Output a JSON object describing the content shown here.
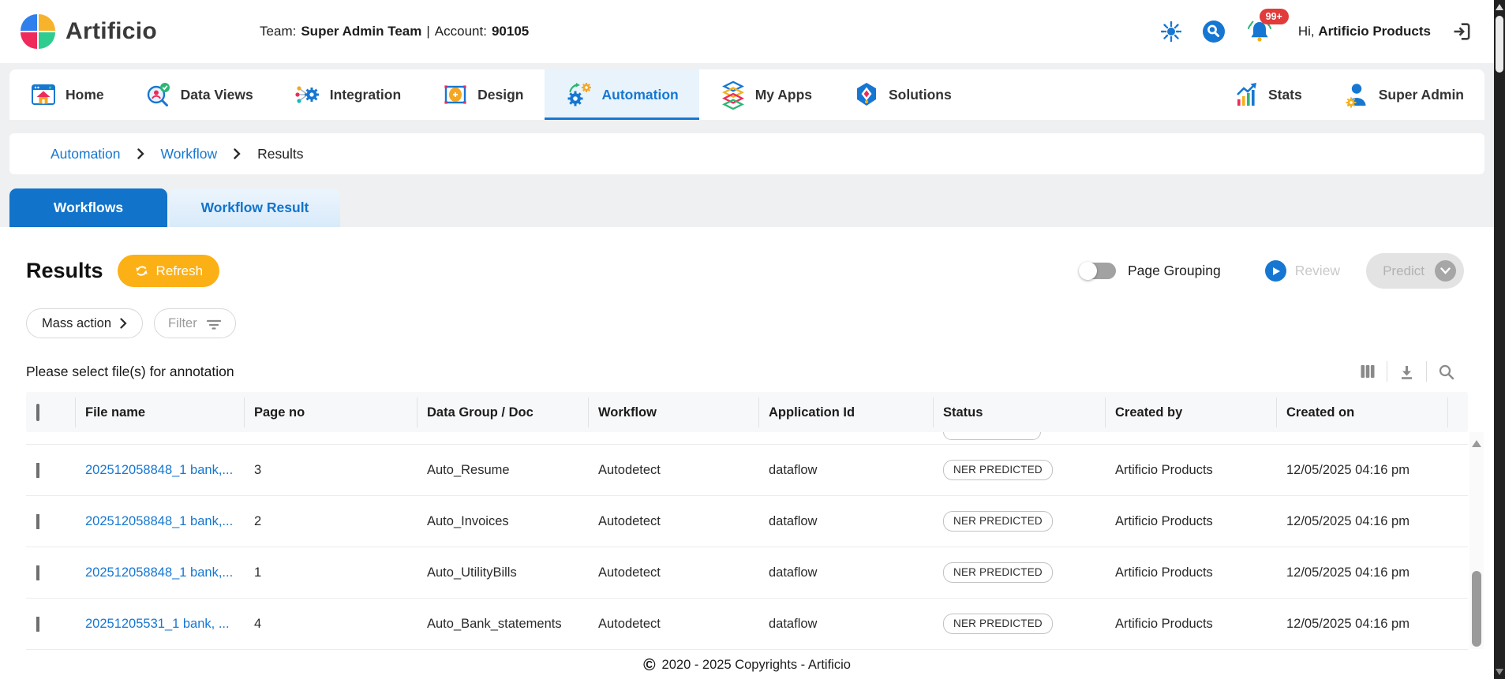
{
  "header": {
    "brand": "Artificio",
    "team_label": "Team:",
    "team_name": "Super Admin Team",
    "divider": "|",
    "account_label": "Account:",
    "account_value": "90105",
    "notification_count": "99+",
    "greeting_prefix": "Hi,",
    "user_name": "Artificio Products"
  },
  "nav": {
    "items": [
      {
        "label": "Home"
      },
      {
        "label": "Data Views"
      },
      {
        "label": "Integration"
      },
      {
        "label": "Design"
      },
      {
        "label": "Automation"
      },
      {
        "label": "My Apps"
      },
      {
        "label": "Solutions"
      }
    ],
    "active": "Automation",
    "right": [
      {
        "label": "Stats"
      },
      {
        "label": "Super Admin"
      }
    ]
  },
  "breadcrumb": {
    "items": [
      {
        "label": "Automation"
      },
      {
        "label": "Workflow"
      },
      {
        "label": "Results"
      }
    ]
  },
  "tabs": [
    {
      "label": "Workflows"
    },
    {
      "label": "Workflow Result"
    }
  ],
  "toolbar": {
    "title": "Results",
    "refresh": "Refresh",
    "page_grouping": "Page Grouping",
    "review": "Review",
    "predict": "Predict",
    "mass_action": "Mass action",
    "filter": "Filter",
    "hint": "Please select file(s) for annotation"
  },
  "table": {
    "columns": [
      "File name",
      "Page no",
      "Data Group / Doc",
      "Workflow",
      "Application Id",
      "Status",
      "Created by",
      "Created on"
    ],
    "rows": [
      {
        "file_name": "202512058848_1 bank,...",
        "page_no": "3",
        "data_group": "Auto_Resume",
        "workflow": "Autodetect",
        "application_id": "dataflow",
        "status": "NER PREDICTED",
        "created_by": "Artificio Products",
        "created_on": "12/05/2025 04:16 pm"
      },
      {
        "file_name": "202512058848_1 bank,...",
        "page_no": "2",
        "data_group": "Auto_Invoices",
        "workflow": "Autodetect",
        "application_id": "dataflow",
        "status": "NER PREDICTED",
        "created_by": "Artificio Products",
        "created_on": "12/05/2025 04:16 pm"
      },
      {
        "file_name": "202512058848_1 bank,...",
        "page_no": "1",
        "data_group": "Auto_UtilityBills",
        "workflow": "Autodetect",
        "application_id": "dataflow",
        "status": "NER PREDICTED",
        "created_by": "Artificio Products",
        "created_on": "12/05/2025 04:16 pm"
      },
      {
        "file_name": "20251205531_1 bank, ...",
        "page_no": "4",
        "data_group": "Auto_Bank_statements",
        "workflow": "Autodetect",
        "application_id": "dataflow",
        "status": "NER PREDICTED",
        "created_by": "Artificio Products",
        "created_on": "12/05/2025 04:16 pm"
      }
    ]
  },
  "footer": {
    "symbol": "©",
    "text": "2020 - 2025 Copyrights - Artificio"
  },
  "colors": {
    "accent_blue": "#1677d2",
    "refresh_orange": "#fbb016",
    "badge_red": "#e13b3b",
    "active_tab_blue": "#1173ca"
  }
}
